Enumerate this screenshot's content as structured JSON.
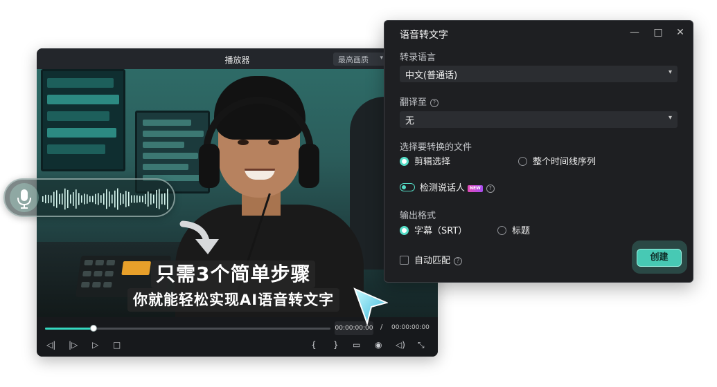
{
  "player": {
    "title": "播放器",
    "quality": "最高画质",
    "caption_line1": "只需3个简单步骤",
    "caption_line2": "你就能轻松实现AI语音转文字",
    "progress": 0.17,
    "current_time": "00:00:00:00",
    "separator": "/",
    "total_time": "00:00:00:00",
    "controls": {
      "prev_frame": "◁|",
      "next_frame": "|▷",
      "play": "▷",
      "stop": "□",
      "mark_in": "{",
      "mark_out": "}",
      "display": "▭",
      "snapshot": "◉",
      "volume": "◁)",
      "fullscreen": "⤡"
    }
  },
  "dialog": {
    "title": "语音转文字",
    "window_buttons": {
      "minimize": "—",
      "maximize": "□",
      "close": "✕"
    },
    "transcribe_lang_label": "转录语言",
    "transcribe_lang_value": "中文(普通话)",
    "translate_label": "翻译至",
    "translate_value": "无",
    "file_select_label": "选择要转换的文件",
    "file_options": [
      "剪辑选择",
      "整个时间线序列"
    ],
    "file_selected": 0,
    "detect_speaker_label": "检测说话人",
    "detect_speaker_on": true,
    "new_badge": "NEW",
    "output_format_label": "输出格式",
    "output_options": [
      "字幕（SRT）",
      "标题"
    ],
    "output_selected": 0,
    "auto_match_label": "自动匹配",
    "auto_match_checked": false,
    "help_glyph": "?",
    "create_button": "创建"
  },
  "colors": {
    "accent": "#55dcc6",
    "dialog_bg": "#1e1f22",
    "player_bg": "#17191c"
  }
}
